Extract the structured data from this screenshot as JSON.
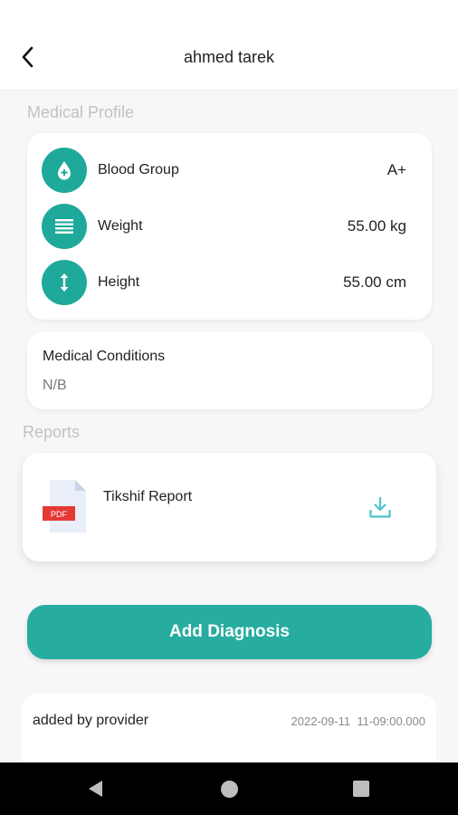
{
  "header": {
    "title": "ahmed tarek",
    "back_icon": "chevron-left-icon"
  },
  "medical_profile": {
    "section_title": "Medical Profile",
    "stats": [
      {
        "label": "Blood Group",
        "value": "A+",
        "icon": "blood-drop-icon"
      },
      {
        "label": "Weight",
        "value": "55.00 kg",
        "icon": "weight-lines-icon"
      },
      {
        "label": "Height",
        "value": "55.00 cm",
        "icon": "height-arrows-icon"
      }
    ]
  },
  "medical_conditions": {
    "title": "Medical Conditions",
    "value": "N/B"
  },
  "reports": {
    "section_title": "Reports",
    "items": [
      {
        "name": "Tikshif Report",
        "file_badge": "PDF",
        "icon": "pdf-file-icon",
        "action_icon": "download-icon"
      }
    ]
  },
  "actions": {
    "add_diagnosis_label": "Add Diagnosis"
  },
  "notes": [
    {
      "author": "added by provider",
      "date": "2022-09-11",
      "time": "11-09:00.000"
    }
  ],
  "navigation_bar": {
    "back_icon": "nav-back-triangle-icon",
    "home_icon": "nav-home-circle-icon",
    "recent_icon": "nav-recent-square-icon"
  },
  "colors": {
    "accent": "#26ad9f",
    "icon_circle": "#1fa99a",
    "download_icon": "#4cc3c7",
    "pdf_badge": "#e53935",
    "section_title": "#c2c2c2",
    "background": "#f7f7f7"
  }
}
